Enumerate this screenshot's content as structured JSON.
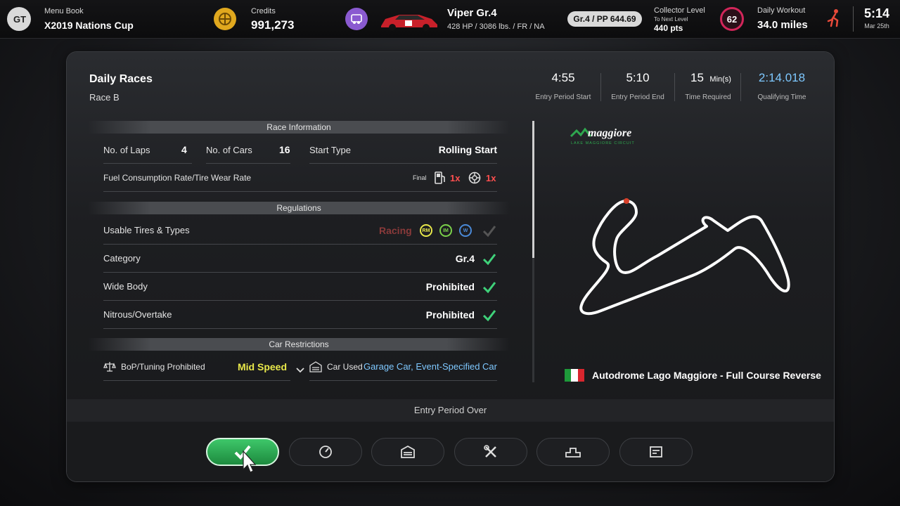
{
  "topbar": {
    "menu_book_label": "Menu Book",
    "menu_book_value": "X2019 Nations Cup",
    "credits_label": "Credits",
    "credits_value": "991,273",
    "car_name": "Viper Gr.4",
    "car_specs": "428 HP / 3086 lbs. / FR / NA",
    "car_pp": "Gr.4 / PP 644.69",
    "collector_label": "Collector Level",
    "collector_sub": "To Next Level",
    "collector_pts": "440 pts",
    "collector_level": "62",
    "workout_label": "Daily Workout",
    "workout_value": "34.0 miles",
    "time": "5:14",
    "date": "Mar 25th"
  },
  "header": {
    "title": "Daily Races",
    "subtitle": "Race B",
    "stats": [
      {
        "value": "4:55",
        "label": "Entry Period Start"
      },
      {
        "value": "5:10",
        "label": "Entry Period End"
      },
      {
        "value": "15",
        "unit": "Min(s)",
        "label": "Time Required"
      },
      {
        "value": "2:14.018",
        "label": "Qualifying Time"
      }
    ]
  },
  "race_info": {
    "section": "Race Information",
    "laps_label": "No. of Laps",
    "laps_value": "4",
    "cars_label": "No. of Cars",
    "cars_value": "16",
    "start_label": "Start Type",
    "start_value": "Rolling Start",
    "fuel_label": "Fuel Consumption Rate/Tire Wear Rate",
    "final_label": "Final",
    "fuel_rate": "1x",
    "tire_rate": "1x"
  },
  "regulations": {
    "section": "Regulations",
    "tires_label": "Usable Tires & Types",
    "tires_value": "Racing",
    "tire_types": [
      "RM",
      "IM",
      "W"
    ],
    "category_label": "Category",
    "category_value": "Gr.4",
    "widebody_label": "Wide Body",
    "widebody_value": "Prohibited",
    "nitrous_label": "Nitrous/Overtake",
    "nitrous_value": "Prohibited"
  },
  "car_restrictions": {
    "section": "Car Restrictions",
    "bop_label": "BoP/Tuning Prohibited",
    "bop_value": "Mid Speed",
    "car_used_label": "Car Used",
    "car_used_value": "Garage Car, Event-Specified Car"
  },
  "track": {
    "logo_text": "maggiore",
    "logo_sub": "LAKE MAGGIORE CIRCUIT",
    "name": "Autodrome Lago Maggiore - Full Course Reverse"
  },
  "footer": {
    "status": "Entry Period Over"
  },
  "colors": {
    "accent_green": "#2fa84f",
    "check_green": "#3fd27a",
    "yellow": "#e8e84a",
    "blue_value": "#7ec8ff",
    "red_rate": "#ff4f4f"
  }
}
